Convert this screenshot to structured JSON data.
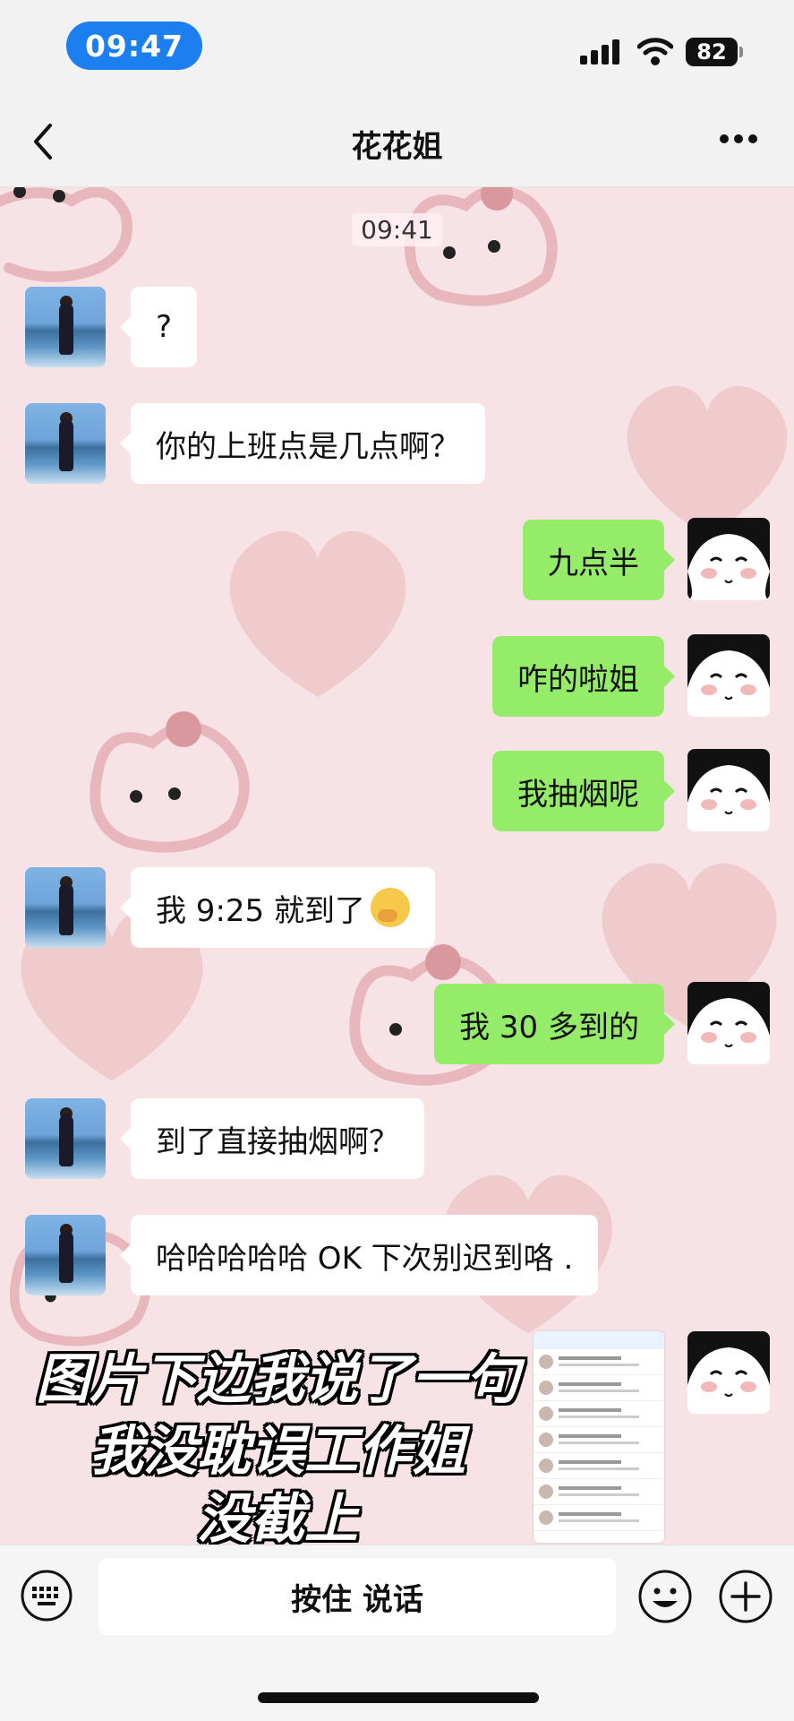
{
  "status_bar": {
    "time": "09:47",
    "battery": "82"
  },
  "nav": {
    "title": "花花姐"
  },
  "chat": {
    "timestamp": "09:41",
    "messages": [
      {
        "side": "left",
        "text": "?"
      },
      {
        "side": "left",
        "text": "你的上班点是几点啊？"
      },
      {
        "side": "right",
        "text": "九点半"
      },
      {
        "side": "right",
        "text": "咋的啦姐"
      },
      {
        "side": "right",
        "text": "我抽烟呢"
      },
      {
        "side": "left",
        "text": "我 9:25 就到了"
      },
      {
        "side": "right",
        "text": "我 30 多到的"
      },
      {
        "side": "left",
        "text": "到了直接抽烟啊？"
      },
      {
        "side": "left",
        "text": "哈哈哈哈哈 OK 下次别迟到咯 ."
      }
    ]
  },
  "overlay_caption": {
    "line1": "图片下边我说了一句",
    "line2": "我没耽误工作姐",
    "line3": "没截上"
  },
  "input_bar": {
    "voice_label": "按住 说话"
  },
  "colors": {
    "bubble_green": "#95ec69",
    "chat_bg": "#f7e3e6",
    "time_pill": "#1b7ff0"
  }
}
